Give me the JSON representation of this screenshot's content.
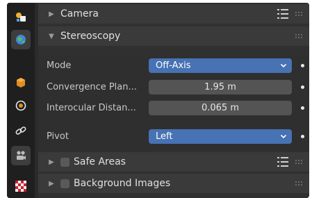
{
  "tabs": [
    {
      "name": "scene-tab",
      "icon": "scene-icon",
      "active": false
    },
    {
      "name": "world-tab",
      "icon": "world-icon",
      "active": true
    },
    {
      "name": "object-tab",
      "icon": "object-icon",
      "active": false
    },
    {
      "name": "physics-tab",
      "icon": "physics-icon",
      "active": false
    },
    {
      "name": "constraints-tab",
      "icon": "constraint-icon",
      "active": false
    },
    {
      "name": "camera-data-tab",
      "icon": "camera-icon",
      "active": true
    },
    {
      "name": "texture-tab",
      "icon": "texture-icon",
      "active": false
    }
  ],
  "panels": {
    "camera": {
      "title": "Camera",
      "expanded": false
    },
    "stereoscopy": {
      "title": "Stereoscopy",
      "expanded": true
    },
    "safe_areas": {
      "title": "Safe Areas",
      "expanded": false,
      "checked": false
    },
    "background_images": {
      "title": "Background Images",
      "expanded": false,
      "checked": false
    }
  },
  "stereoscopy": {
    "mode_label": "Mode",
    "mode_value": "Off-Axis",
    "convergence_label": "Convergence Plan...",
    "convergence_value": "1.95 m",
    "interocular_label": "Interocular Distan...",
    "interocular_value": "0.065 m",
    "pivot_label": "Pivot",
    "pivot_value": "Left"
  },
  "colors": {
    "accent": "#4772b3",
    "panel_bg": "#303030",
    "header_bg": "#3a3a3a",
    "tabbar_bg": "#1f1f1f"
  }
}
